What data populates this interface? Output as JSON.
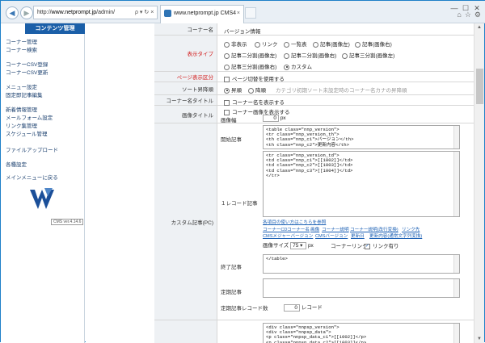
{
  "browser": {
    "address_prefix": "http://",
    "address_domain": "www.netprompt.jp",
    "address_path": "/admin/",
    "address_icons": "ρ ▾ ↻ ×",
    "tab_title": "www.netprompt.jp  CMS4",
    "tab_close": "×",
    "win_controls": [
      "—",
      "☐",
      "✕"
    ],
    "right_tools": [
      "⌂",
      "☆",
      "⚙"
    ]
  },
  "sidebar": {
    "header": "コンテンツ管理",
    "links": [
      "コーナー管理",
      "コーナー検索",
      "コーナーCSV登録",
      "コーナーCSV更新",
      "メニュー設定",
      "固定即記事編集",
      "新着情報管理",
      "メールフォーム設定",
      "リンク集管理",
      "スケジュール管理",
      "ファイルアップロード",
      "各種設定",
      "メインメニューに戻る"
    ],
    "version": "CMS ver.4.14.6"
  },
  "form": {
    "corner_name": {
      "label": "コーナー名",
      "value": "バージョン情報"
    },
    "display_type": {
      "label": "表示タイプ",
      "options": [
        "非表示",
        "リンク",
        "一覧表",
        "記事(画像左)",
        "記事(画像右)",
        "記事二分割(画像左)",
        "記事二分割(画像右)",
        "記事三分割(画像左)",
        "記事三分割(画像右)",
        "カスタム"
      ],
      "selected": "カスタム"
    },
    "page_display": {
      "label": "ページ表示区分",
      "option": "ページ切替を使用する"
    },
    "sort_order": {
      "label": "ソート昇降順",
      "options": [
        "昇順",
        "降順"
      ],
      "selected": "昇順",
      "hint": "カテゴリ初期ソート未設定時のコーナー名カナの昇降順"
    },
    "corner_title": {
      "label": "コーナー名タイトル",
      "option": "コーナー名を表示する"
    },
    "image_title": {
      "label": "画像タイトル",
      "option": "コーナー画像を表示する",
      "width_label": "画像幅",
      "width_value": "0",
      "width_unit": "px"
    },
    "custom": {
      "label": "カスタム記事(PC)",
      "start_label": "開始記事",
      "start_code": "<table class=\"nnp_version\">\n<tr class=\"nnp_version_th\">\n<th class=\"nnp_c1\">バージョン</th>\n<th class=\"nnp_c2\">更新内容</th>",
      "record_label": "１レコード記事",
      "record_code": "<tr class=\"nnp_version_td\">\n<td class=\"nnp_c1\">[[1002]]</td>\n<td class=\"nnp_c2\">[[1003]]</td>\n<td class=\"nnp_c3\">[[1004]]</td>\n</tr>",
      "help_link": "各項目の使い方はこちらを参照",
      "tags_row1": [
        "コーナーCD",
        "コーナー名",
        "画像",
        "コーナー説明",
        "コーナー説明(改行変換)",
        "リンク先"
      ],
      "tags_row2": [
        "CMSメジャーバージョン",
        "CMSバージョン",
        "更新日",
        "更新内容(通常文字列変換)"
      ],
      "img_size_label": "画像サイズ",
      "img_size_value": "75",
      "img_size_unit": "px",
      "corner_link_label": "コーナーリンク",
      "link_option": "リンク有り",
      "end_label": "終了記事",
      "end_code": "</table>",
      "fixed_label": "定期記事",
      "fixed_count_label": "定期記事レコード数",
      "fixed_count_value": "0",
      "fixed_count_unit": "レコード"
    },
    "custom_sp": {
      "code": "<div class=\"nnpsp_version\">\n<div class=\"nnpsp_data\">\n<p class=\"nnpsp_data_c1\">[[1002]]</p>\n<p class=\"nnpsp_data_c2\">[[1003]]</p>"
    }
  }
}
